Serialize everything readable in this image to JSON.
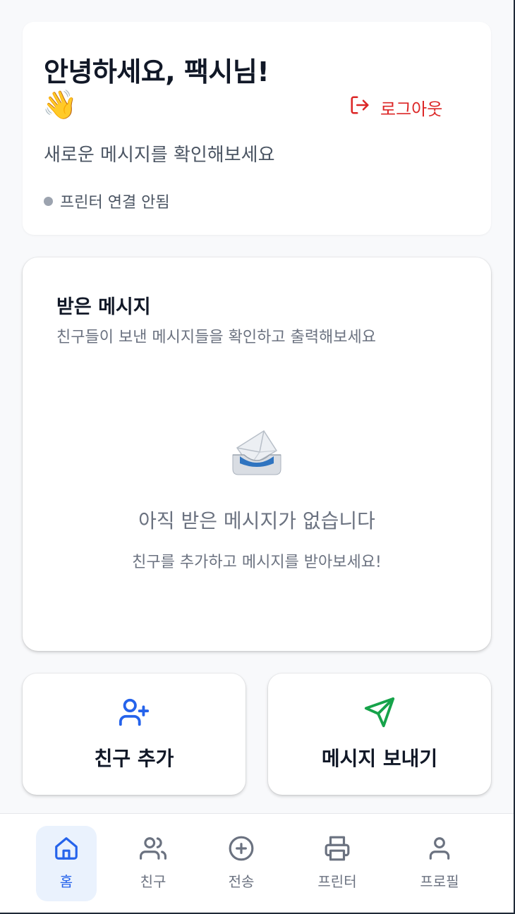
{
  "greeting": {
    "title": "안녕하세요, 팩시님!",
    "emoji": "👋",
    "subtitle": "새로운 메시지를 확인해보세요",
    "printer_status": "프린터 연결 안됨",
    "logout_label": "로그아웃"
  },
  "inbox": {
    "title": "받은 메시지",
    "subtitle": "친구들이 보낸 메시지들을 확인하고 출력해보세요",
    "empty_icon": "inbox-tray-icon",
    "empty_title": "아직 받은 메시지가 없습니다",
    "empty_subtitle": "친구를 추가하고 메시지를 받아보세요!"
  },
  "actions": [
    {
      "label": "친구 추가",
      "icon": "user-plus-icon",
      "color": "#2563eb"
    },
    {
      "label": "메시지 보내기",
      "icon": "send-icon",
      "color": "#16a34a"
    }
  ],
  "nav": {
    "items": [
      {
        "label": "홈",
        "icon": "home-icon",
        "active": true
      },
      {
        "label": "친구",
        "icon": "users-icon",
        "active": false
      },
      {
        "label": "전송",
        "icon": "plus-circle-icon",
        "active": false
      },
      {
        "label": "프린터",
        "icon": "printer-icon",
        "active": false
      },
      {
        "label": "프로필",
        "icon": "user-icon",
        "active": false
      }
    ]
  },
  "colors": {
    "accent": "#2563eb",
    "danger": "#dc2626",
    "success": "#16a34a",
    "muted": "#6b7280",
    "background": "#f8f9fb"
  }
}
